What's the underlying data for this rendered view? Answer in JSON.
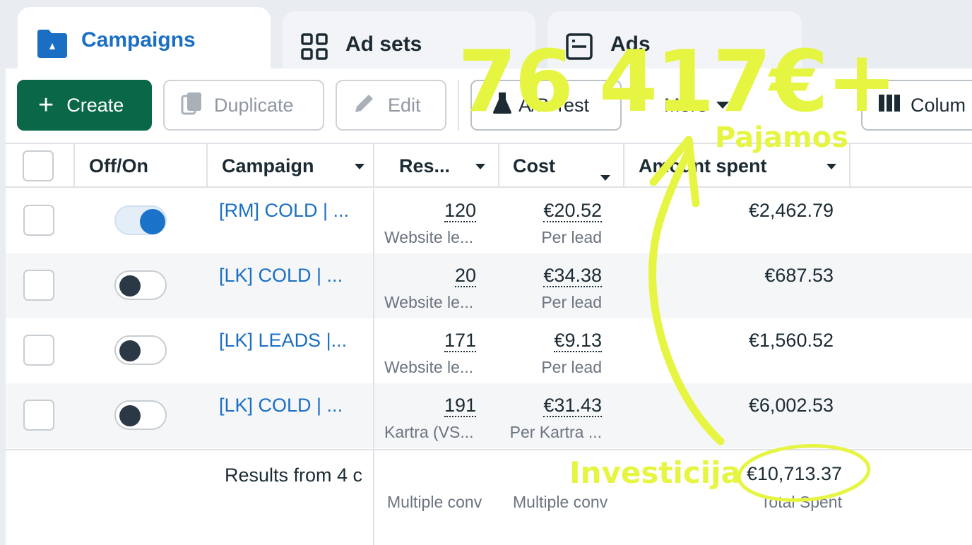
{
  "tabs": [
    {
      "label": "Campaigns",
      "icon": "folder-icon",
      "active": true
    },
    {
      "label": "Ad sets",
      "icon": "grid-icon",
      "active": false
    },
    {
      "label": "Ads",
      "icon": "ad-window-icon",
      "active": false
    }
  ],
  "toolbar": {
    "create": "Create",
    "duplicate": "Duplicate",
    "edit": "Edit",
    "ab_test": "A/B Test",
    "more": "More",
    "columns": "Colum"
  },
  "columns": {
    "off_on": "Off/On",
    "campaign": "Campaign",
    "results": "Res...",
    "cost": "Cost",
    "amount_spent": "Amount spent"
  },
  "rows": [
    {
      "on": true,
      "name": "[RM] COLD | ...",
      "results": "120",
      "results_sub": "Website le...",
      "cost": "€20.52",
      "cost_sub": "Per lead",
      "spent": "€2,462.79"
    },
    {
      "on": false,
      "name": "[LK] COLD | ...",
      "results": "20",
      "results_sub": "Website le...",
      "cost": "€34.38",
      "cost_sub": "Per lead",
      "spent": "€687.53"
    },
    {
      "on": false,
      "name": "[LK] LEADS |...",
      "results": "171",
      "results_sub": "Website le...",
      "cost": "€9.13",
      "cost_sub": "Per lead",
      "spent": "€1,560.52"
    },
    {
      "on": false,
      "name": "[LK] COLD | ...",
      "results": "191",
      "results_sub": "Kartra (VS...",
      "cost": "€31.43",
      "cost_sub": "Per Kartra ...",
      "spent": "€6,002.53"
    }
  ],
  "summary": {
    "label": "Results from 4 c",
    "results_sub": "Multiple conv",
    "cost_sub": "Multiple conv",
    "total": "€10,713.37",
    "total_sub": "Total Spent"
  },
  "annotations": {
    "revenue": "76 417€+",
    "revenue_label": "Pajamos",
    "investment_label": "Investicija",
    "highlight_color": "#e5f542"
  },
  "colors": {
    "accent": "#1a6fc4",
    "create_button": "#0a6848"
  }
}
